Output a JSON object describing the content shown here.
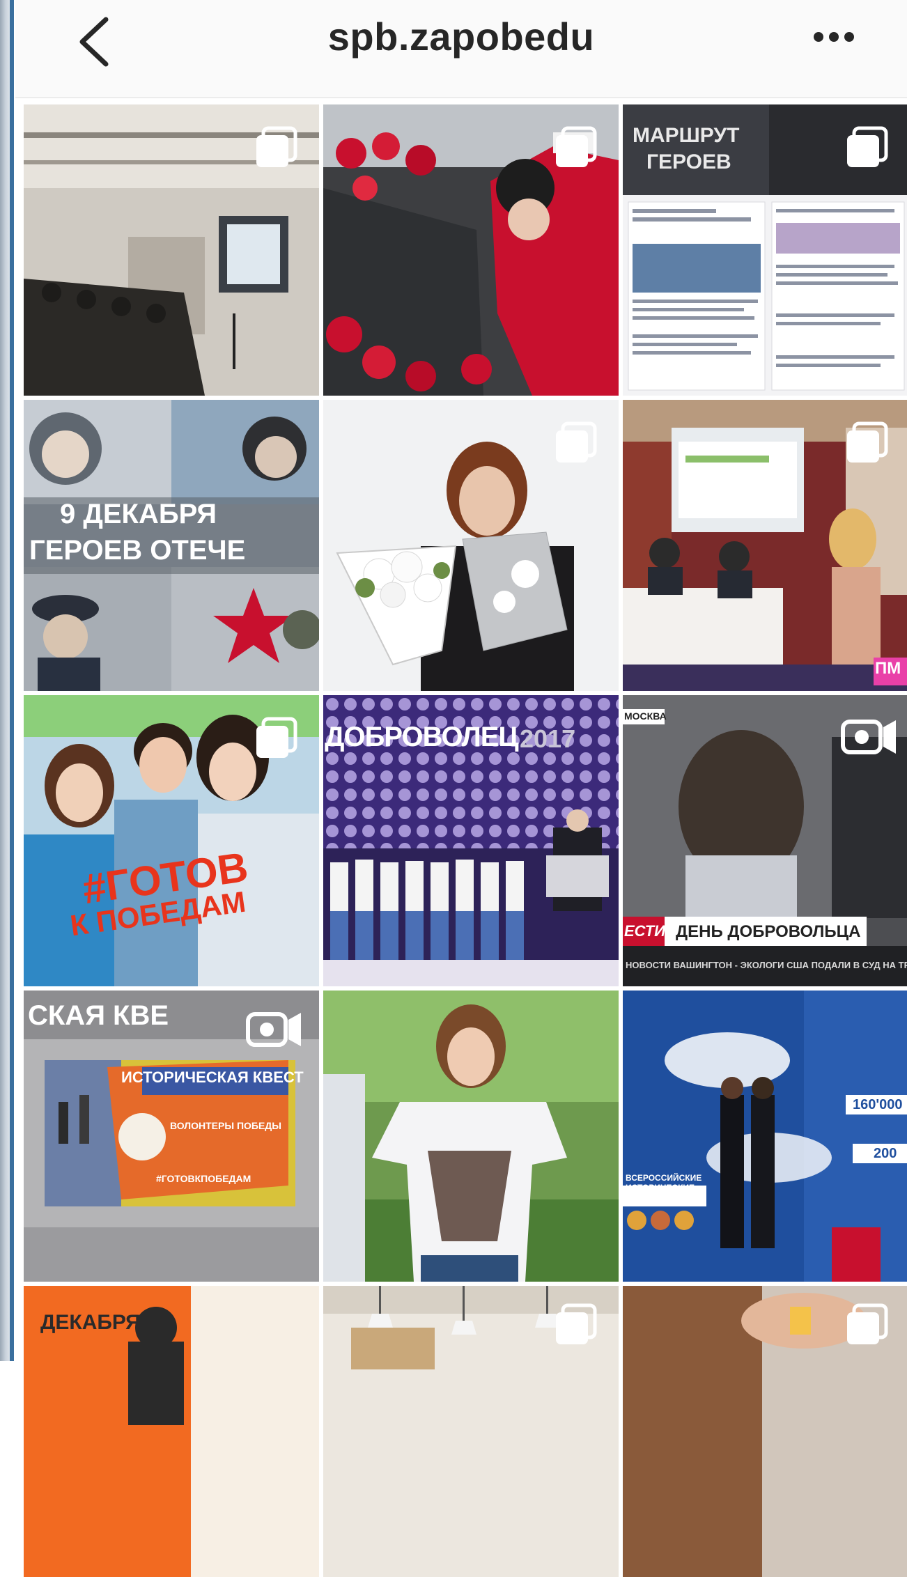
{
  "header": {
    "title": "spb.zapobedu",
    "back_icon": "chevron-left-icon",
    "more_icon": "more-horizontal-icon"
  },
  "colors": {
    "header_bg": "#fafafa",
    "title_text": "#262626",
    "accent_red": "#c8102e",
    "accent_blue": "#1f4f9e"
  },
  "posts": [
    {
      "id": "conference-hall",
      "badge": "multiple-photos-icon"
    },
    {
      "id": "flowers-memorial",
      "badge": "multiple-photos-icon"
    },
    {
      "id": "heroes-route",
      "badge": "multiple-photos-icon",
      "text": [
        "МАРШРУТ",
        "ГЕРОЕВ"
      ]
    },
    {
      "id": "heroes-day-collage",
      "text": [
        "9 ДЕКАБРЯ",
        "ГЕРОЕВ ОТЕЧЕ"
      ]
    },
    {
      "id": "woman-bouquet",
      "badge": "multiple-photos-icon"
    },
    {
      "id": "press-conference",
      "badge": "multiple-photos-icon",
      "text": [
        "ПМ"
      ]
    },
    {
      "id": "gotov-k-pobedam",
      "badge": "multiple-photos-icon",
      "text": [
        "#ГОТОВ",
        "К ПОБЕДАМ"
      ]
    },
    {
      "id": "dobrovolets-2017",
      "text": [
        "ДОБРОВОЛЕЦ",
        "2017"
      ]
    },
    {
      "id": "tv-volunteer-day",
      "badge": "igtv-video-icon",
      "text": [
        "МОСКВА",
        "ЕСТИЯ",
        "ДЕНЬ ДОБРОВОЛЬЦА",
        "НОВОСТИ ВАШИНГТОН - ЭКОЛОГИ США ПОДАЛИ В СУД НА ТРАМПА"
      ]
    },
    {
      "id": "historical-quest",
      "badge": "igtv-video-icon",
      "text": [
        "СКАЯ КВЕ",
        "ИСТОРИЧЕСКАЯ КВЕСТ",
        "ВОЛОНТЕРЫ ПОБЕДЫ",
        "#ГОТОВКПОБЕДАМ"
      ]
    },
    {
      "id": "heart-hands"
    },
    {
      "id": "volunteers-stand",
      "text": [
        "160'000",
        "200",
        "ВСЕРОССИЙСКИЕ ИСТОРИЧЕСКИЕ КВЕСТЫ"
      ]
    },
    {
      "id": "december-poster",
      "text": [
        "ДЕКАБРЯ"
      ]
    },
    {
      "id": "hall-lamps",
      "badge": "multiple-photos-icon"
    },
    {
      "id": "hands-closeup",
      "badge": "multiple-photos-icon"
    }
  ]
}
